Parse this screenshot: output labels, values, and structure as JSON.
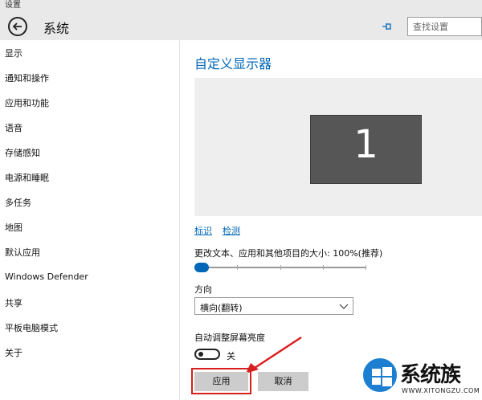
{
  "window": {
    "title": "设置"
  },
  "header": {
    "title": "系统",
    "search_placeholder": "查找设置"
  },
  "sidebar": {
    "items": [
      {
        "label": "显示"
      },
      {
        "label": "通知和操作"
      },
      {
        "label": "应用和功能"
      },
      {
        "label": "语音"
      },
      {
        "label": "存储感知"
      },
      {
        "label": "电源和睡眠"
      },
      {
        "label": "多任务"
      },
      {
        "label": "地图"
      },
      {
        "label": "默认应用"
      },
      {
        "label": "Windows Defender"
      },
      {
        "label": "共享"
      },
      {
        "label": "平板电脑模式"
      },
      {
        "label": "关于"
      }
    ]
  },
  "main": {
    "title": "自定义显示器",
    "monitor_number": "1",
    "identify_link": "标识",
    "detect_link": "检测",
    "scale_label": "更改文本、应用和其他项目的大小: 100%(推荐)",
    "scale_slider_fraction": 0.0,
    "orientation_label": "方向",
    "orientation_value": "横向(翻转)",
    "brightness_label": "自动调整屏幕亮度",
    "brightness_toggle_label": "关",
    "apply_button": "应用",
    "cancel_button": "取消"
  },
  "watermark": {
    "text": "系统族",
    "url": "WWW.XITONGZU.COM"
  },
  "colors": {
    "accent": "#0067b8",
    "highlight": "#d81e1e"
  }
}
